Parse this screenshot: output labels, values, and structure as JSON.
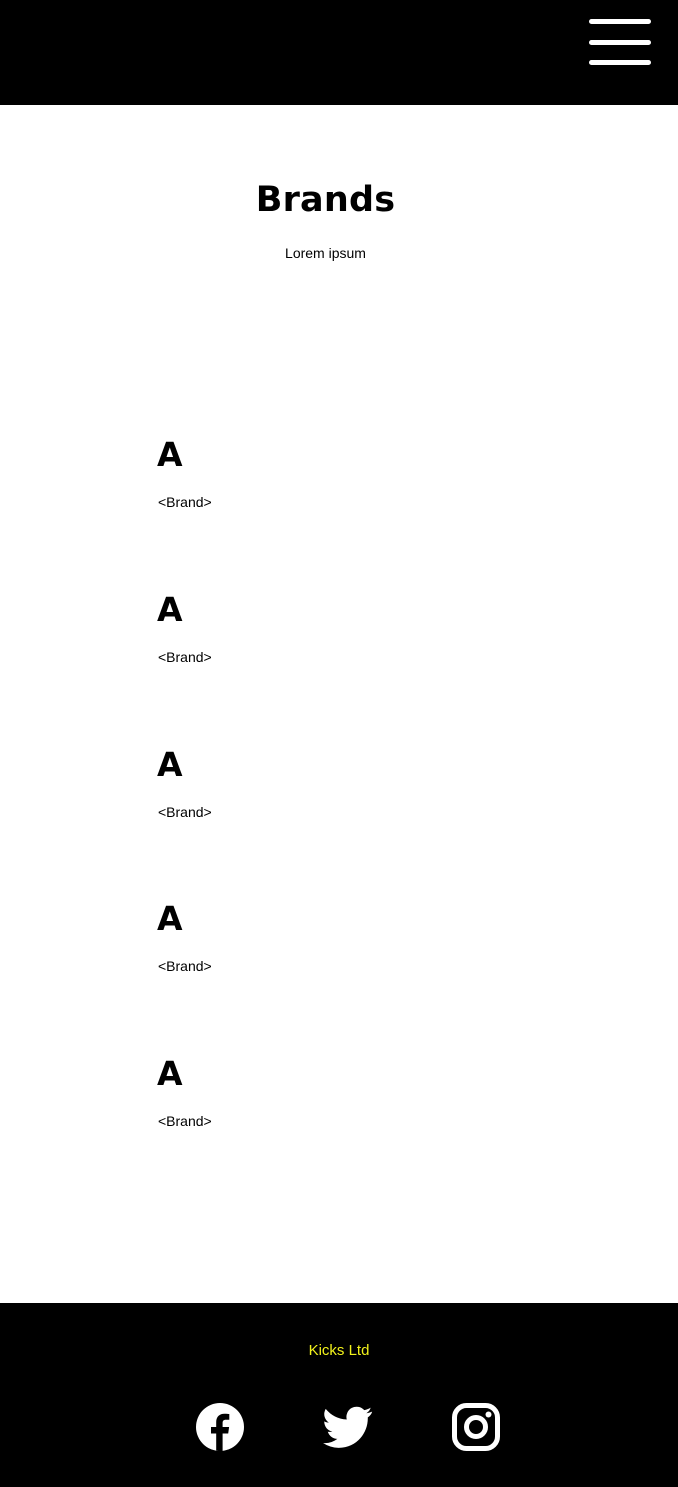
{
  "header": {
    "menu_icon": "hamburger-menu-icon",
    "background": "#000000"
  },
  "hero": {
    "title": "Brands",
    "subtitle": "Lorem ipsum"
  },
  "brands": [
    {
      "letter": "A",
      "name": "<Brand>"
    },
    {
      "letter": "A",
      "name": "<Brand>"
    },
    {
      "letter": "A",
      "name": "<Brand>"
    },
    {
      "letter": "A",
      "name": "<Brand>"
    },
    {
      "letter": "A",
      "name": "<Brand>"
    }
  ],
  "footer": {
    "company": "Kicks Ltd",
    "company_color": "#f2f21b",
    "social_icons": [
      "facebook-icon",
      "twitter-icon",
      "instagram-icon"
    ]
  }
}
